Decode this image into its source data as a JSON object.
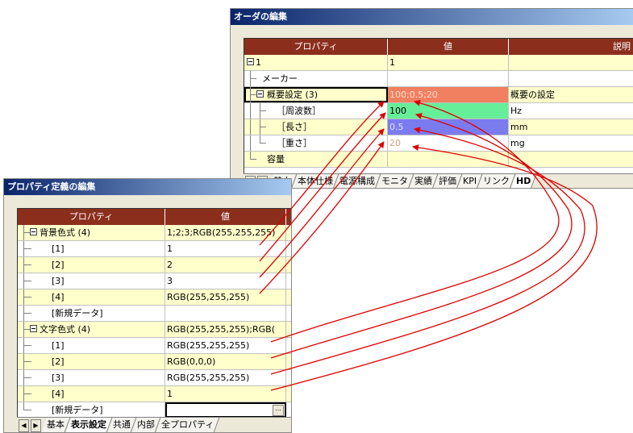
{
  "order_window": {
    "title": "オーダの編集",
    "columns": [
      "プロパティ",
      "値",
      "説明"
    ],
    "rows": [
      {
        "label": "1",
        "value": "1",
        "desc": ""
      },
      {
        "label": "メーカー",
        "value": "",
        "desc": ""
      },
      {
        "label": "概要設定 (3)",
        "value": "100;0.5;20",
        "desc": "概要の設定"
      },
      {
        "label": "［周波数］",
        "value": "100",
        "desc": "Hz"
      },
      {
        "label": "［長さ］",
        "value": "0.5",
        "desc": "mm"
      },
      {
        "label": "［重さ］",
        "value": "20",
        "desc": "mg"
      },
      {
        "label": "容量",
        "value": "",
        "desc": ""
      }
    ],
    "tabs": [
      "基本",
      "本体仕様",
      "電源構成",
      "モニタ",
      "実績",
      "評価",
      "KPI",
      "リンク",
      "HD"
    ],
    "active_tab": "HD",
    "value_colors": {
      "summary_bg": "#f08060",
      "freq_bg": "#66ee99",
      "length_bg": "#7b7bf0",
      "weight_text": "#e0a080"
    }
  },
  "property_window": {
    "title": "プロパティ定義の編集",
    "columns": [
      "プロパティ",
      "値"
    ],
    "rows": [
      {
        "label": "背景色式 (4)",
        "value": "1;2;3;RGB(255,255,255)"
      },
      {
        "label": "[1]",
        "value": "1"
      },
      {
        "label": "[2]",
        "value": "2"
      },
      {
        "label": "[3]",
        "value": "3"
      },
      {
        "label": "[4]",
        "value": "RGB(255,255,255)"
      },
      {
        "label": "[新規データ]",
        "value": ""
      },
      {
        "label": "文字色式 (4)",
        "value": "RGB(255,255,255);RGB("
      },
      {
        "label": "[1]",
        "value": "RGB(255,255,255)"
      },
      {
        "label": "[2]",
        "value": "RGB(0,0,0)"
      },
      {
        "label": "[3]",
        "value": "RGB(255,255,255)"
      },
      {
        "label": "[4]",
        "value": "1"
      },
      {
        "label": "[新規データ]",
        "value": ""
      }
    ],
    "tabs": [
      "基本",
      "表示設定",
      "共通",
      "内部",
      "全プロパティ"
    ],
    "active_tab": "表示設定",
    "ellipsis_label": "..."
  },
  "colors": {
    "header_bg": "#8b2e1c",
    "arrow": "#dd0000"
  }
}
